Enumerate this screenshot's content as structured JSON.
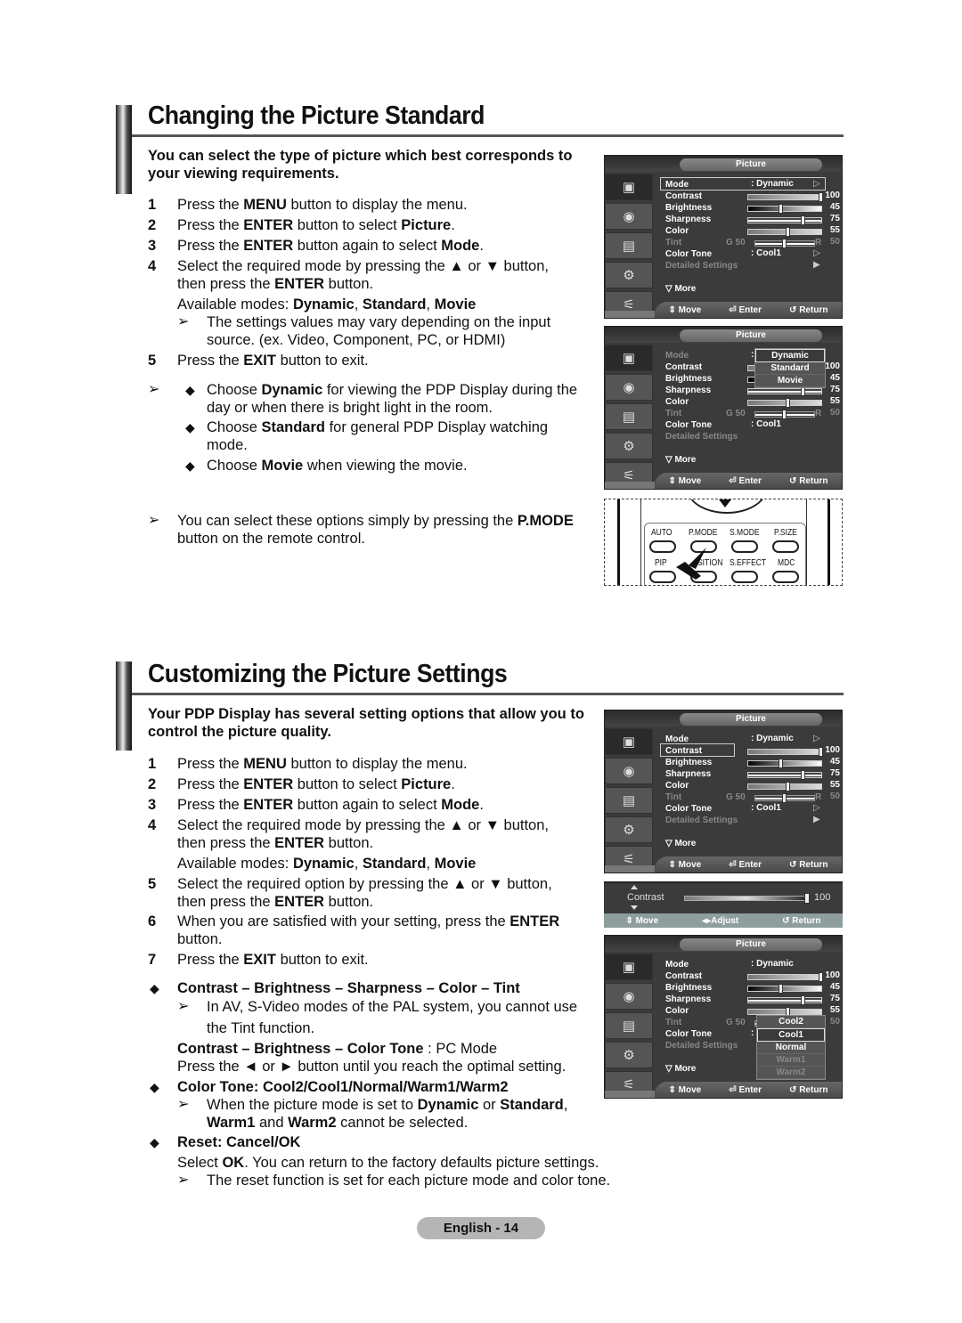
{
  "section1": {
    "title": "Changing the Picture Standard",
    "intro": "You can select the type of picture which best corresponds to your viewing requirements.",
    "steps": [
      {
        "num": "1",
        "pre": "Press the ",
        "b1": "MENU",
        "post": " button to display the menu."
      },
      {
        "num": "2",
        "pre": "Press the ",
        "b1": "ENTER",
        "mid": " button to select ",
        "b2": "Picture",
        "post": "."
      },
      {
        "num": "3",
        "pre": "Press the ",
        "b1": "ENTER",
        "mid": " button again to select ",
        "b2": "Mode",
        "post": "."
      },
      {
        "num": "4",
        "line1": "Select the required mode by pressing the ▲ or ▼ button,",
        "line2_pre": "then press the ",
        "line2_b": "ENTER",
        "line2_post": " button."
      },
      {
        "num": "5",
        "pre": "Press the ",
        "b1": "EXIT",
        "post": " button to exit."
      }
    ],
    "available_label": "Available modes: ",
    "modes": [
      "Dynamic",
      "Standard",
      "Movie"
    ],
    "note_line1": "The settings values may vary depending on the input",
    "note_line2": "source. (ex. Video, Component, PC, or HDMI)",
    "tips": [
      {
        "pre": "Choose ",
        "b": "Dynamic",
        "post1": " for viewing the PDP Display during the",
        "post2": "day or when there is bright light in the room."
      },
      {
        "pre": "Choose ",
        "b": "Standard",
        "post1": " for general PDP Display watching",
        "post2": "mode."
      },
      {
        "pre": "Choose ",
        "b": "Movie",
        "post1": " when viewing the movie.",
        "post2": ""
      }
    ],
    "pmode_note_pre": "You can select these options simply by pressing the ",
    "pmode_note_b": "P.MODE",
    "pmode_note_line2": "button on the remote control."
  },
  "section2": {
    "title": "Customizing the Picture Settings",
    "intro": "Your PDP Display has several setting options that allow you to control the picture quality.",
    "steps": [
      {
        "num": "1",
        "pre": "Press the ",
        "b1": "MENU",
        "post": " button to display the menu."
      },
      {
        "num": "2",
        "pre": "Press the ",
        "b1": "ENTER",
        "mid": " button to select ",
        "b2": "Picture",
        "post": "."
      },
      {
        "num": "3",
        "pre": "Press the ",
        "b1": "ENTER",
        "mid": " button again to select ",
        "b2": "Mode",
        "post": "."
      },
      {
        "num": "4",
        "line1": "Select the required mode by pressing the ▲ or ▼ button,",
        "line2_pre": "then press the ",
        "line2_b": "ENTER",
        "line2_post": " button."
      },
      {
        "num": "5",
        "line1": "Select the required option by pressing the ▲ or ▼ button,",
        "line2_pre": "then press the ",
        "line2_b": "ENTER",
        "line2_post": " button."
      },
      {
        "num": "6",
        "line1_pre": "When you are satisfied with your setting, press the ",
        "line1_b": "ENTER",
        "line2": "button."
      },
      {
        "num": "7",
        "pre": "Press the ",
        "b1": "EXIT",
        "post": " button to exit."
      }
    ],
    "available_label": "Available modes: ",
    "modes": [
      "Dynamic",
      "Standard",
      "Movie"
    ],
    "bullets": {
      "b1_title": "Contrast – Brightness – Sharpness – Color – Tint",
      "b1_note1": "In AV, S-Video modes of the PAL system, you cannot use",
      "b1_note2": "the Tint function.",
      "pc_b": "Contrast – Brightness – Color Tone",
      "pc_post": " : PC Mode",
      "press_line": "Press the ◄ or ► button until you reach the optimal setting.",
      "b2_label": "Color Tone",
      "b2_values": ": Cool2/Cool1/Normal/Warm1/Warm2",
      "b2_note_pre": "When the picture mode is set to ",
      "b2_note_b1": "Dynamic",
      "b2_note_mid": " or ",
      "b2_note_b2": "Standard",
      "b2_note_post": ",",
      "b2_note2_b1": "Warm1",
      "b2_note2_mid": " and ",
      "b2_note2_b2": "Warm2",
      "b2_note2_post": " cannot be selected.",
      "b3_label": "Reset",
      "b3_values": ": Cancel/OK",
      "b3_line_pre": "Select ",
      "b3_line_b": "OK",
      "b3_line_post": ". You can return to the factory defaults picture settings.",
      "b3_note": "The reset function is set for each picture mode and color tone."
    }
  },
  "osd": {
    "title": "Picture",
    "rows": {
      "mode": "Mode",
      "contrast": "Contrast",
      "brightness": "Brightness",
      "sharpness": "Sharpness",
      "color": "Color",
      "tint": "Tint",
      "color_tone": "Color Tone",
      "detailed": "Detailed Settings",
      "more": "▽ More"
    },
    "values": {
      "mode": ": Dynamic",
      "contrast": 100,
      "brightness": 45,
      "sharpness": 75,
      "color": 55,
      "tint_g": "G  50",
      "tint_r": "R",
      "tint_value": 50,
      "color_tone": ": Cool1"
    },
    "footer": {
      "move": "Move",
      "enter": "Enter",
      "return": "Return",
      "adjust": "Adjust"
    },
    "mode_options": [
      "Dynamic",
      "Standard",
      "Movie"
    ],
    "tone_options": [
      "Cool2",
      "Cool1",
      "Normal",
      "Warm1",
      "Warm2"
    ],
    "adjust_label": "Contrast",
    "adjust_value": "100"
  },
  "remote": {
    "row1": [
      "AUTO",
      "P.MODE",
      "S.MODE",
      "P.SIZE"
    ],
    "row2": [
      "PIP",
      "SITION",
      "S.EFFECT",
      "MDC"
    ]
  },
  "footer": {
    "page_label": "English - 14"
  }
}
